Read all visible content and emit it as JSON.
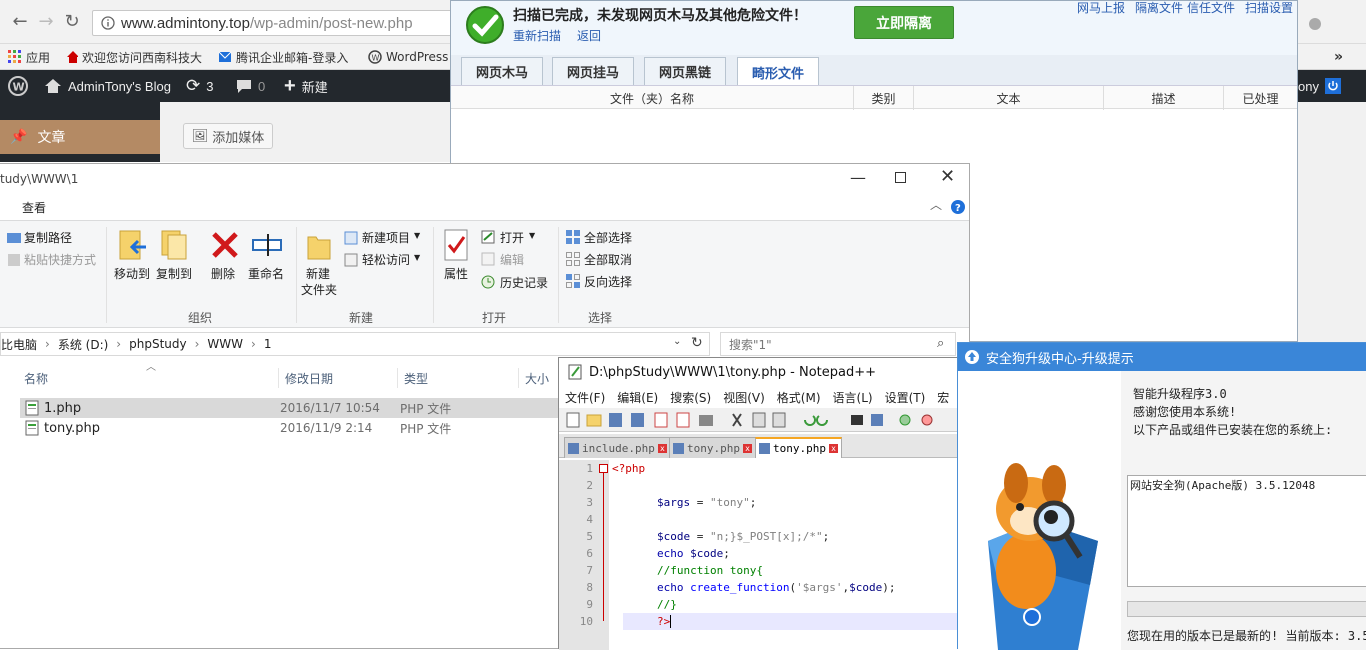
{
  "browser": {
    "url_host": "www.admintony.top",
    "url_path": "/wp-admin/post-new.php",
    "bookmarks": [
      {
        "label": "应用"
      },
      {
        "label": "欢迎您访问西南科技大"
      },
      {
        "label": "腾讯企业邮箱-登录入"
      },
      {
        "label": "WordPress"
      }
    ],
    "more": "»"
  },
  "wordpress": {
    "site_name": "AdminTony's Blog",
    "updates_count": "3",
    "comments_count": "0",
    "new_label": "新建",
    "menu_active": "文章",
    "add_media": "添加媒体",
    "user_fragment": "ony"
  },
  "scanner": {
    "title": "扫描已完成，未发现网页木马及其他危险文件！",
    "rescan": "重新扫描",
    "back": "返回",
    "isolate_button": "立即隔离",
    "top_links": [
      "网马上报",
      "隔离文件",
      "信任文件",
      "扫描设置"
    ],
    "tabs": [
      "网页木马",
      "网页挂马",
      "网页黑链",
      "畸形文件"
    ],
    "active_tab": "畸形文件",
    "columns": [
      "文件（夹）名称",
      "类别",
      "文本",
      "描述",
      "已处理"
    ]
  },
  "explorer": {
    "title_fragment": "tudy\\WWW\\1",
    "menu_view": "查看",
    "ribbon": {
      "copy_path": "复制路径",
      "paste_shortcut": "粘贴快捷方式",
      "move_to": "移动到",
      "copy_to": "复制到",
      "delete": "删除",
      "rename": "重命名",
      "new_folder_line1": "新建",
      "new_folder_line2": "文件夹",
      "new_item": "新建项目",
      "easy_access": "轻松访问",
      "properties": "属性",
      "open": "打开",
      "edit": "编辑",
      "history": "历史记录",
      "select_all": "全部选择",
      "select_none": "全部取消",
      "invert_selection": "反向选择",
      "group_organize": "组织",
      "group_new": "新建",
      "group_open": "打开",
      "group_select": "选择"
    },
    "breadcrumb": [
      "比电脑",
      "系统 (D:)",
      "phpStudy",
      "WWW",
      "1"
    ],
    "search_placeholder": "搜索\"1\"",
    "columns": [
      "名称",
      "修改日期",
      "类型",
      "大小"
    ],
    "files": [
      {
        "name": "1.php",
        "date": "2016/11/7 10:54",
        "type": "PHP 文件"
      },
      {
        "name": "tony.php",
        "date": "2016/11/9 2:14",
        "type": "PHP 文件"
      }
    ]
  },
  "notepad": {
    "title": "D:\\phpStudy\\WWW\\1\\tony.php - Notepad++",
    "menu": [
      "文件(F)",
      "编辑(E)",
      "搜索(S)",
      "视图(V)",
      "格式(M)",
      "语言(L)",
      "设置(T)",
      "宏"
    ],
    "tabs": [
      "include.php",
      "tony.php",
      "tony.php"
    ],
    "line_numbers": [
      "1",
      "2",
      "3",
      "4",
      "5",
      "6",
      "7",
      "8",
      "9",
      "10"
    ]
  },
  "upgrade": {
    "title": "安全狗升级中心-升级提示",
    "line1": "智能升级程序3.0",
    "line2": "感谢您使用本系统!",
    "line3": "以下产品或组件已安装在您的系统上:",
    "product": "网站安全狗(Apache版) 3.5.12048",
    "status": "您现在用的版本已是最新的! 当前版本: 3.5"
  },
  "colors": {
    "wp_dark": "#23282d",
    "wp_active": "#b48a64",
    "scanner_green": "#4aa63a",
    "dialog_blue": "#3a86d8"
  }
}
